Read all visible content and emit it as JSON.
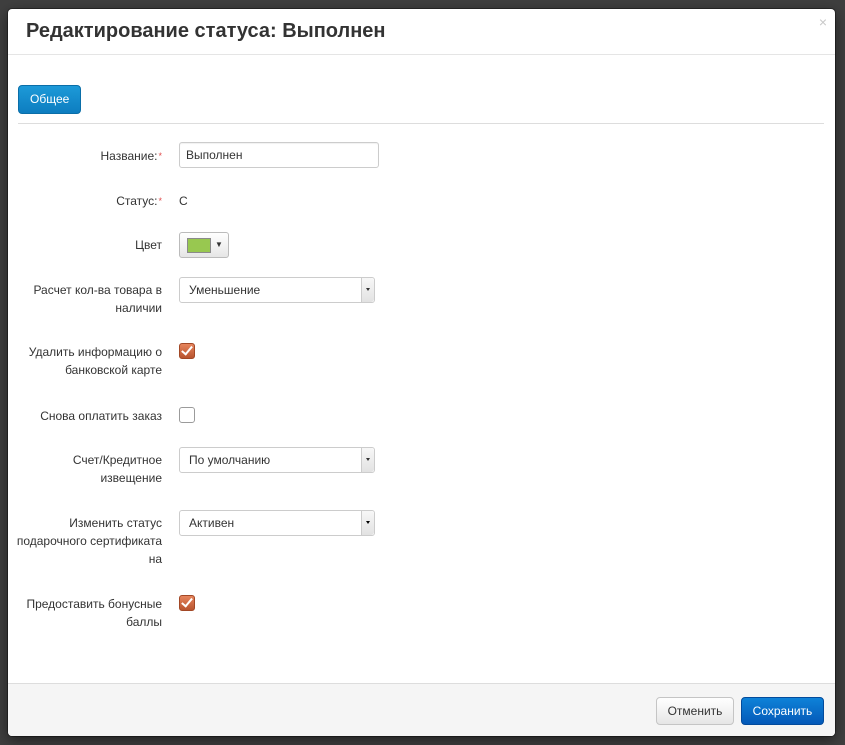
{
  "dialog": {
    "title": "Редактирование статуса: Выполнен",
    "close_glyph": "×"
  },
  "tabs": [
    {
      "label": "Общее",
      "active": true
    }
  ],
  "form": {
    "name": {
      "label": "Название:",
      "required_mark": "*",
      "value": "Выполнен"
    },
    "status": {
      "label": "Статус:",
      "required_mark": "*",
      "value": "C"
    },
    "color": {
      "label": "Цвет",
      "value": "#98c850",
      "caret": "▼"
    },
    "stock_calc": {
      "label": "Расчет кол-ва товара в наличии",
      "value": "Уменьшение"
    },
    "remove_card_info": {
      "label": "Удалить информацию о банковской карте",
      "checked": true
    },
    "pay_again": {
      "label": "Снова оплатить заказ",
      "checked": false
    },
    "invoice": {
      "label": "Счет/Кредитное извещение",
      "value": "По умолчанию"
    },
    "gift_cert_status": {
      "label": "Изменить статус подарочного сертификата на",
      "value": "Активен"
    },
    "bonus_points": {
      "label": "Предоставить бонусные баллы",
      "checked": true
    }
  },
  "footer": {
    "cancel_label": "Отменить",
    "save_label": "Сохранить"
  },
  "colors": {
    "primary": "#0d7dc0",
    "checkbox_accent": "#c8643c"
  }
}
